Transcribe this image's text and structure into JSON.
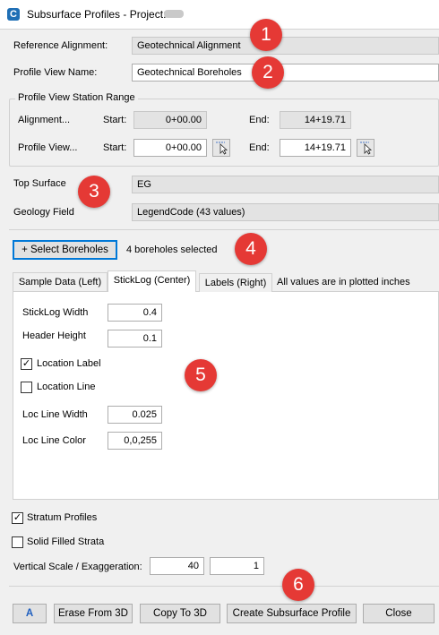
{
  "window": {
    "title": "Subsurface Profiles - Project:",
    "app_icon_letter": "C"
  },
  "form": {
    "reference_alignment_label": "Reference Alignment:",
    "reference_alignment_value": "Geotechnical Alignment",
    "profile_view_name_label": "Profile View Name:",
    "profile_view_name_value": "Geotechnical Boreholes"
  },
  "station_range": {
    "title": "Profile View Station Range",
    "alignment_label": "Alignment...",
    "alignment_start_label": "Start:",
    "alignment_start_value": "0+00.00",
    "alignment_end_label": "End:",
    "alignment_end_value": "14+19.71",
    "profile_view_label": "Profile View...",
    "profile_view_start_label": "Start:",
    "profile_view_start_value": "0+00.00",
    "profile_view_end_label": "End:",
    "profile_view_end_value": "14+19.71"
  },
  "surface": {
    "top_surface_label": "Top Surface",
    "top_surface_value": "EG",
    "geology_field_label": "Geology Field",
    "geology_field_value": "LegendCode (43 values)"
  },
  "boreholes": {
    "select_button_label": "+ Select Boreholes",
    "selected_status": "4 boreholes selected"
  },
  "tabs": {
    "items": [
      {
        "label": "Sample Data (Left)"
      },
      {
        "label": "StickLog (Center)"
      },
      {
        "label": "Labels (Right)"
      }
    ],
    "note": "All values are in plotted inches"
  },
  "sticklog": {
    "stick_width_label": "StickLog Width",
    "stick_width_value": "0.4",
    "header_height_label": "Header Height",
    "header_height_value": "0.1",
    "location_label_label": "Location Label",
    "location_label_checked": "✓",
    "location_line_label": "Location Line",
    "location_line_checked": "",
    "loc_line_width_label": "Loc Line Width",
    "loc_line_width_value": "0.025",
    "loc_line_color_label": "Loc Line Color",
    "loc_line_color_value": "0,0,255"
  },
  "options": {
    "stratum_profiles_label": "Stratum Profiles",
    "stratum_profiles_checked": "✓",
    "solid_filled_strata_label": "Solid Filled Strata",
    "solid_filled_strata_checked": "",
    "vertical_scale_label": "Vertical Scale / Exaggeration:",
    "vertical_scale_value": "40",
    "exaggeration_value": "1"
  },
  "footer": {
    "font_button_label": "A",
    "erase_button_label": "Erase From 3D",
    "copy_button_label": "Copy To 3D",
    "create_button_label": "Create Subsurface Profile",
    "close_button_label": "Close"
  },
  "callouts": [
    "1",
    "2",
    "3",
    "4",
    "5",
    "6"
  ],
  "colors": {
    "callout": "#e53935",
    "accent": "#0078d7",
    "readonly_field": "#e3e3e3",
    "app_icon": "#1f6fb5"
  }
}
